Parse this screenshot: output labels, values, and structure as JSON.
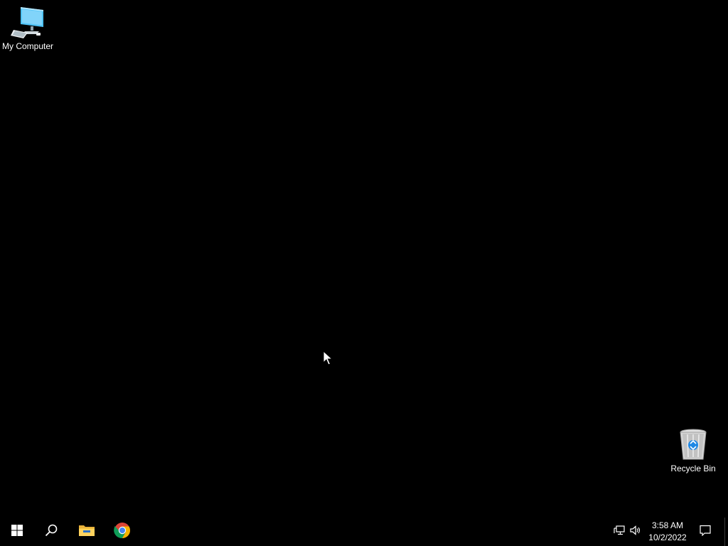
{
  "desktop": {
    "background_color": "#000000",
    "icons": [
      {
        "label": "My Computer",
        "icon": "computer-icon"
      },
      {
        "label": "Recycle Bin",
        "icon": "recycle-bin-icon"
      }
    ]
  },
  "taskbar": {
    "background_color": "#000000",
    "pinned": [
      {
        "name": "start",
        "icon": "windows-logo-icon"
      },
      {
        "name": "search",
        "icon": "search-icon"
      },
      {
        "name": "file-explorer",
        "icon": "folder-icon"
      },
      {
        "name": "chrome",
        "icon": "chrome-icon"
      }
    ],
    "tray": {
      "icons": [
        "network-icon",
        "volume-icon",
        "notification-icon"
      ],
      "time": "3:58 AM",
      "date": "10/2/2022"
    }
  }
}
